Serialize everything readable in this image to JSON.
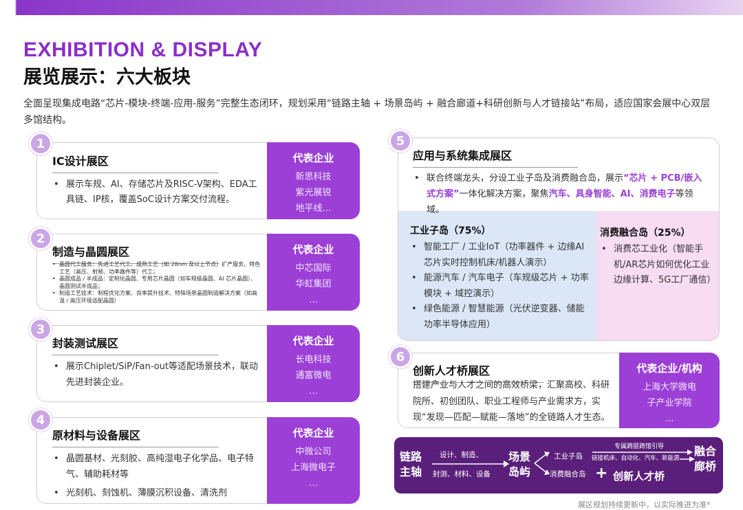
{
  "title_en": "EXHIBITION & DISPLAY",
  "title_cn": "展览展示：六大板块",
  "intro": "全面呈现集成电路“芯片-模块-终端-应用-服务”完整生态闭环，规划采用“链路主轴 + 场景岛屿 + 融合廊道+科研创新与人才链接站”布局，适应国家会展中心双层多馆结构。",
  "zones": [
    {
      "num": "1",
      "title": "IC设计展区",
      "rep_label": "代表企业",
      "companies": [
        "新思科技",
        "紫光展锐",
        "地平线…"
      ],
      "bullets": [
        "展示车规、AI、存储芯片及RISC-V架构、EDA工具链、IP核，覆盖SoC设计方案交付流程。"
      ]
    },
    {
      "num": "2",
      "title": "制造与晶圆展区",
      "rep_label": "代表企业",
      "companies": [
        "中芯国际",
        "华虹集团",
        "…"
      ],
      "bullets": [
        "晶圆代工服务：先进工艺代工、成熟工艺（如 28nm 及以上节点）扩产服务、特色工艺（高压、射频、功率器件等）代工；",
        "晶圆成品 / 半成品：定制化晶圆、专用芯片晶圆（如车规级晶圆、AI 芯片晶圆）、晶圆测试半成品；",
        "制造工艺技术：制程优化方案、良率提升技术、特殊场景晶圆制造解决方案（如高温 / 高压环境适配晶圆）"
      ]
    },
    {
      "num": "3",
      "title": "封装测试展区",
      "rep_label": "代表企业",
      "companies": [
        "长电科技",
        "通富微电",
        "…"
      ],
      "bullets": [
        "展示Chiplet/SiP/Fan-out等适配场景技术，联动先进封装企业。"
      ]
    },
    {
      "num": "4",
      "title": "原材料与设备展区",
      "rep_label": "代表企业",
      "companies": [
        "中微公司",
        "上海微电子",
        "…"
      ],
      "bullets": [
        "晶圆基材、光刻胶、高纯湿电子化学品、电子特气、辅助耗材等",
        "光刻机、刻蚀机、薄膜沉积设备、清洗剂"
      ]
    },
    {
      "num": "5",
      "title": "应用与系统集成展区",
      "intro_a": "联合终端龙头，分设工业子岛及消费融合岛，展示",
      "intro_hl": "“芯片 + PCB/嵌入式方案”",
      "intro_b": "一体化解决方案，聚焦",
      "intro_hl2": "汽车、具身智能、AI、消费电子",
      "intro_c": "等领域。"
    },
    {
      "num": "6",
      "title": "创新人才桥展区",
      "text": "搭建产业与人才之间的高效桥梁，汇聚高校、科研院所、初创团队、职业工程师与产业需求方，实现“发现—匹配—赋能—落地”的全链路人才生态。",
      "rep_label": "代表企业/机构",
      "companies": [
        "上海大学微电",
        "子产业学院",
        "…"
      ]
    }
  ],
  "industrial": {
    "title": "工业子岛（75%）",
    "items": [
      "智能工厂 / 工业IoT（功率器件 + 边缘AI芯片实时控制机床/机器人演示）",
      "能源汽车 / 汽车电子（车规级芯片 + 功率模块 + 域控演示）",
      "绿色能源 / 智慧能源（光伏逆变器、储能功率半导体应用）"
    ]
  },
  "consumer": {
    "title": "消费融合岛（25%）",
    "items": [
      "消费芯工业化（智能手机/AR芯片如何优化工业边缘计算、5G工厂通信）"
    ]
  },
  "flow": {
    "main_axis": "链路主轴",
    "arrow1_top": "设计、制造、",
    "arrow1_bottom": "封测、材料、设备",
    "islands": "场景岛屿",
    "branch_top": "工业子岛",
    "branch_bottom": "消费融合岛",
    "corridor_label": "专属跨层跨馆引导",
    "corridor_items": "链接机床、自动化、汽车、新能源",
    "fusion": "融合廊桥",
    "plus": "+",
    "talent": "创新人才桥"
  },
  "footnote": "展区规划持续更新中，以实际推进为准*",
  "colors": {
    "accent": "#9b3fd6",
    "title": "#8a2ec9",
    "dark": "#5a1f7a",
    "light_blue": "#dbe7f7",
    "light_pink": "#f7dcf2"
  }
}
